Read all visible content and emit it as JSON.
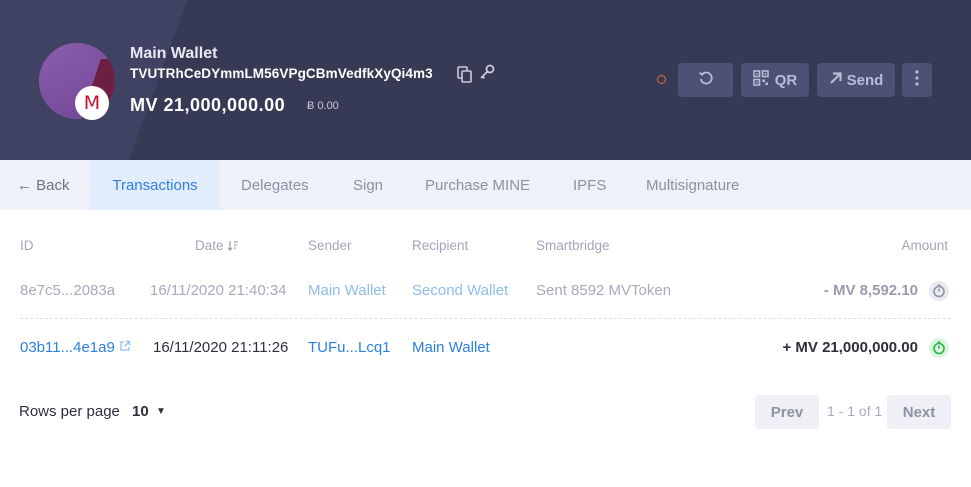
{
  "header": {
    "wallet_name": "Main Wallet",
    "address": "TVUTRhCeDYmmLM56VPgCBmVedfkXyQi4m3",
    "balance": "MV 21,000,000.00",
    "balance_alt": "Ƀ 0.00",
    "avatar_letter": "M",
    "buttons": {
      "qr": "QR",
      "send": "Send"
    },
    "status_color": "#e0703a"
  },
  "tabs": {
    "back": "← Back",
    "items": [
      "Transactions",
      "Delegates",
      "Sign",
      "Purchase MINE",
      "IPFS",
      "Multisignature"
    ],
    "active": "Transactions"
  },
  "table": {
    "headers": {
      "id": "ID",
      "date": "Date",
      "sender": "Sender",
      "recipient": "Recipient",
      "smartbridge": "Smartbridge",
      "amount": "Amount"
    },
    "rows": [
      {
        "id": "8e7c5...2083a",
        "date": "16/11/2020 21:40:34",
        "sender": "Main Wallet",
        "recipient": "Second Wallet",
        "smartbridge": "Sent 8592 MVToken",
        "amount": "- MV 8,592.10",
        "status": "pending"
      },
      {
        "id": "03b11...4e1a9",
        "date": "16/11/2020 21:11:26",
        "sender": "TUFu...Lcq1",
        "recipient": "Main Wallet",
        "smartbridge": "",
        "amount": "+ MV 21,000,000.00",
        "status": "confirmed"
      }
    ]
  },
  "pagination": {
    "rows_per_page_label": "Rows per page",
    "rows_per_page_value": "10",
    "prev": "Prev",
    "info": "1 - 1 of 1",
    "next": "Next"
  },
  "colors": {
    "accent": "#2d80df",
    "header_bg": "#373a55",
    "confirmed": "#27b544"
  }
}
